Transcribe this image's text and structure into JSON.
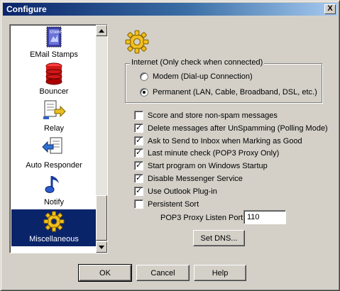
{
  "window": {
    "title": "Configure",
    "close_label": "X"
  },
  "sidebar": {
    "items": [
      {
        "label": "EMail Stamps"
      },
      {
        "label": "Bouncer"
      },
      {
        "label": "Relay"
      },
      {
        "label": "Auto Responder"
      },
      {
        "label": "Notify"
      },
      {
        "label": "Miscellaneous",
        "selected": true
      }
    ]
  },
  "main": {
    "group_label": "Internet (Only check when connected)",
    "radios": [
      {
        "label": "Modem (Dial-up Connection)",
        "checked": false
      },
      {
        "label": "Permanent (LAN, Cable, Broadband, DSL, etc.)",
        "checked": true
      }
    ],
    "checkboxes": [
      {
        "label": "Score and store non-spam messages",
        "checked": false
      },
      {
        "label": "Delete messages after UnSpamming (Polling Mode)",
        "checked": true
      },
      {
        "label": "Ask to Send to Inbox when Marking as Good",
        "checked": true
      },
      {
        "label": "Last minute check (POP3 Proxy Only)",
        "checked": true
      },
      {
        "label": "Start program on Windows Startup",
        "checked": true
      },
      {
        "label": "Disable Messenger Service",
        "checked": true
      },
      {
        "label": "Use Outlook Plug-in",
        "checked": true
      },
      {
        "label": "Persistent Sort",
        "checked": false
      }
    ],
    "port_label": "POP3 Proxy Listen Port:",
    "port_value": "110",
    "set_dns_label": "Set DNS..."
  },
  "footer": {
    "ok_label": "OK",
    "cancel_label": "Cancel",
    "help_label": "Help"
  }
}
